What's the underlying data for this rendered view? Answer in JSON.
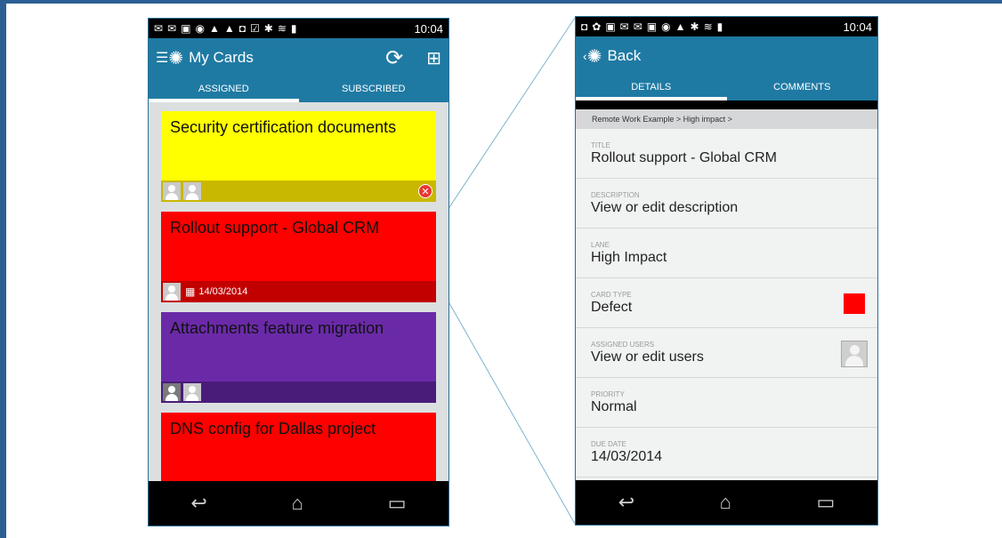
{
  "status_bar": {
    "time": "10:04"
  },
  "left_screen": {
    "title": "My Cards",
    "tabs": [
      "ASSIGNED",
      "SUBSCRIBED"
    ],
    "cards": [
      {
        "title": "Security certification documents",
        "color": "#ffff00",
        "footer_color": "#c9b800",
        "date": ""
      },
      {
        "title": "Rollout support - Global CRM",
        "color": "#ff0000",
        "footer_color": "#c20000",
        "date": "14/03/2014"
      },
      {
        "title": "Attachments feature migration",
        "color": "#6a2aa8",
        "footer_color": "#4a1c7a",
        "date": ""
      },
      {
        "title": "DNS config for Dallas project",
        "color": "#ff0000",
        "footer_color": "#c20000",
        "date": ""
      }
    ]
  },
  "right_screen": {
    "back_label": "Back",
    "tabs": [
      "DETAILS",
      "COMMENTS"
    ],
    "breadcrumb": "Remote Work Example > High impact >",
    "fields": [
      {
        "label": "TITLE",
        "value": "Rollout support - Global CRM"
      },
      {
        "label": "DESCRIPTION",
        "value": "View or edit description"
      },
      {
        "label": "LANE",
        "value": "High Impact"
      },
      {
        "label": "CARD TYPE",
        "value": "Defect",
        "swatch_color": "#ff0000"
      },
      {
        "label": "ASSIGNED USERS",
        "value": "View or edit users"
      },
      {
        "label": "PRIORITY",
        "value": "Normal"
      },
      {
        "label": "DUE DATE",
        "value": "14/03/2014"
      }
    ]
  },
  "icons": {
    "menu": "menu-icon",
    "gear": "gear-icon",
    "refresh": "refresh-icon",
    "add_card": "add-card-icon",
    "back": "back-icon",
    "home": "home-icon",
    "recents": "recents-icon",
    "calendar": "calendar-icon",
    "remove": "remove-icon"
  }
}
